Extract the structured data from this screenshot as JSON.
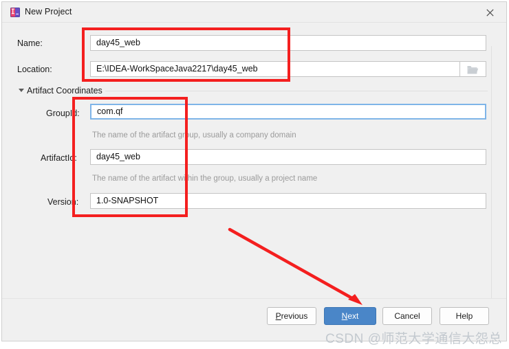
{
  "window": {
    "title": "New Project",
    "icon": "intellij-idea-icon",
    "close_label": "✕"
  },
  "form": {
    "name": {
      "label": "Name:",
      "value": "day45_web",
      "placeholder": ""
    },
    "location": {
      "label": "Location:",
      "value": "E:\\IDEA-WorkSpaceJava2217\\day45_web",
      "placeholder": "",
      "browse_icon": "folder-icon"
    },
    "section": {
      "label": "Artifact Coordinates",
      "caret": "triangle-down-icon",
      "expanded": true
    },
    "group_id": {
      "label": "GroupId:",
      "value": "com.qf",
      "placeholder": "",
      "helper": "The name of the artifact group, usually a company domain",
      "focused": true
    },
    "artifact_id": {
      "label": "ArtifactId:",
      "value": "day45_web",
      "placeholder": "",
      "helper": "The name of the artifact within the group, usually a project name",
      "focused": false
    },
    "version": {
      "label": "Version:",
      "value": "1.0-SNAPSHOT",
      "placeholder": "",
      "focused": false
    }
  },
  "footer": {
    "buttons": [
      {
        "id": "previous",
        "label": "Previous",
        "mnemonic": "P",
        "primary": false
      },
      {
        "id": "next",
        "label": "Next",
        "mnemonic": "N",
        "primary": true
      },
      {
        "id": "cancel",
        "label": "Cancel",
        "mnemonic": "",
        "primary": false
      },
      {
        "id": "help",
        "label": "Help",
        "mnemonic": "",
        "primary": false
      }
    ]
  },
  "annotations": {
    "color": "#f41f1f",
    "boxes": [
      {
        "name": "name-location-highlight"
      },
      {
        "name": "artifact-fields-highlight"
      }
    ],
    "arrow": {
      "name": "arrow-to-next-button"
    }
  },
  "watermark": {
    "text": "CSDN @师范大学通信大怨总"
  }
}
